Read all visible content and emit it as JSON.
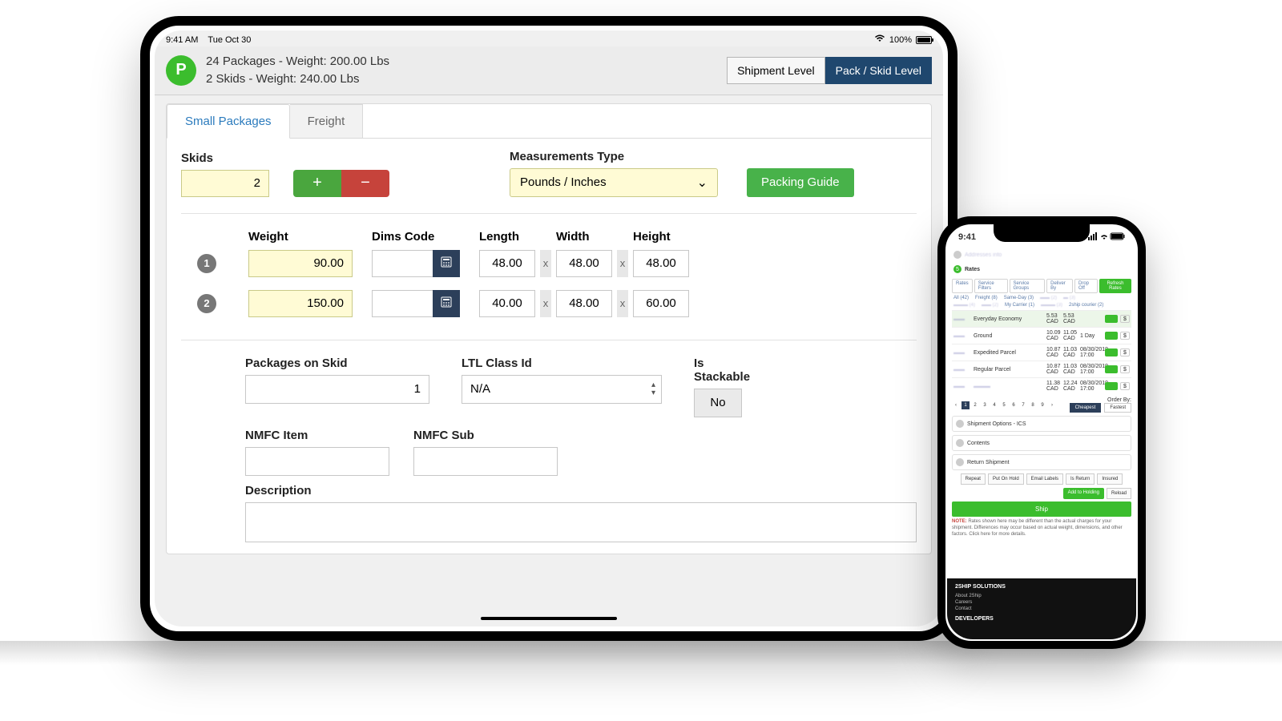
{
  "ipad": {
    "status": {
      "time": "9:41 AM",
      "date": "Tue Oct 30",
      "battery": "100%"
    },
    "header": {
      "badge": "P",
      "line1": "24 Packages - Weight: 200.00 Lbs",
      "line2": "2 Skids - Weight: 240.00 Lbs",
      "shipment_level": "Shipment Level",
      "pack_skid_level": "Pack / Skid Level"
    },
    "tabs": {
      "small": "Small Packages",
      "freight": "Freight"
    },
    "controls": {
      "skids_label": "Skids",
      "skids_value": "2",
      "measurements_label": "Measurements Type",
      "measurements_value": "Pounds / Inches",
      "packing_guide": "Packing Guide"
    },
    "columns": {
      "weight": "Weight",
      "dims": "Dims Code",
      "length": "Length",
      "width": "Width",
      "height": "Height"
    },
    "rows": [
      {
        "n": "1",
        "weight": "90.00",
        "dims": "",
        "l": "48.00",
        "w": "48.00",
        "h": "48.00"
      },
      {
        "n": "2",
        "weight": "150.00",
        "dims": "",
        "l": "40.00",
        "w": "48.00",
        "h": "60.00"
      }
    ],
    "x": "x",
    "bottom": {
      "packages_label": "Packages on Skid",
      "packages_value": "1",
      "ltl_label": "LTL Class Id",
      "ltl_value": "N/A",
      "stackable_label": "Is Stackable",
      "stackable_value": "No",
      "nmfc_item_label": "NMFC Item",
      "nmfc_item_value": "",
      "nmfc_sub_label": "NMFC Sub",
      "nmfc_sub_value": "",
      "description_label": "Description",
      "description_value": ""
    }
  },
  "iphone": {
    "time": "9:41",
    "sections": {
      "addresses": "Addresses into",
      "rates": "Rates"
    },
    "subtabs": [
      "Rates",
      "Service Filters",
      "Service Groups",
      "Deliver By",
      "Drop Off"
    ],
    "refresh": "Refresh Rates",
    "filters": [
      "All (42)",
      "Freight (8)",
      "Same-Day (3)",
      "",
      "",
      ""
    ],
    "carriers": [
      "",
      "",
      "My Carrier (1)",
      "",
      "2ship courier (2)"
    ],
    "rate_rows": [
      {
        "svc": "Everyday Economy",
        "p1": "5.53 CAD",
        "p2": "5.53 CAD",
        "eta": "",
        "hl": true
      },
      {
        "svc": "Ground",
        "p1": "10.09 CAD",
        "p2": "11.05 CAD",
        "eta": "1 Day"
      },
      {
        "svc": "Expedited Parcel",
        "p1": "10.87 CAD",
        "p2": "11.03 CAD",
        "eta": "08/30/2019 17:00"
      },
      {
        "svc": "Regular Parcel",
        "p1": "10.87 CAD",
        "p2": "11.03 CAD",
        "eta": "08/30/2019 17:00"
      },
      {
        "svc": "",
        "p1": "11.38 CAD",
        "p2": "12.24 CAD",
        "eta": "08/30/2019 17:00"
      }
    ],
    "money": "$",
    "pager": [
      "1",
      "2",
      "3",
      "4",
      "5",
      "6",
      "7",
      "8",
      "9"
    ],
    "orderby_label": "Order By:",
    "orderby_cheapest": "Cheapest",
    "orderby_fastest": "Fastest",
    "opt1": "Shipment Options - ICS",
    "opt2": "Contents",
    "opt3": "Return Shipment",
    "actions": [
      "Repeat",
      "Put On Hold",
      "Email Labels",
      "Is Return",
      "Insured"
    ],
    "add_holding": "Add to Holding",
    "reload": "Reload",
    "ship": "Ship",
    "note_label": "NOTE:",
    "note_text": "Rates shown here may be different than the actual charges for your shipment. Differences may occur based on actual weight, dimensions, and other factors. Click here for more details.",
    "footer": {
      "h1": "2SHIP SOLUTIONS",
      "l1": "About 2Ship",
      "l2": "Careers",
      "l3": "Contact",
      "h2": "DEVELOPERS"
    }
  }
}
